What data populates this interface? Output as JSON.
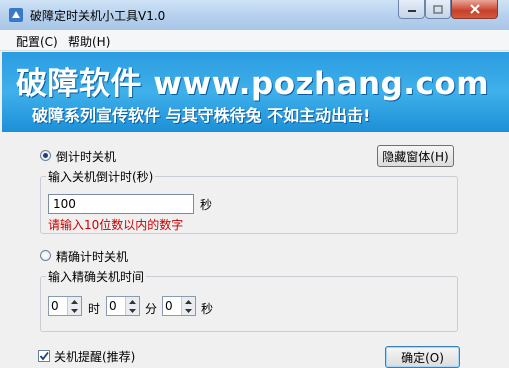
{
  "window": {
    "title": "破障定时关机小工具V1.0"
  },
  "menu": {
    "items": [
      "配置(C)",
      "帮助(H)"
    ]
  },
  "banner": {
    "title": "破障软件 www.pozhang.com",
    "subtitle": "破障系列宣传软件 与其守株待兔 不如主动出击!"
  },
  "countdown": {
    "radio_label": "倒计时关机",
    "selected": true,
    "group_label": "输入关机倒计时(秒)",
    "input_value": "100",
    "unit": "秒",
    "hint": "请输入10位数以内的数字",
    "hide_button": "隐藏窗体(H)"
  },
  "exact": {
    "radio_label": "精确计时关机",
    "selected": false,
    "group_label": "输入精确关机时间",
    "hour": "0",
    "hour_unit": "时",
    "minute": "0",
    "minute_unit": "分",
    "second": "0",
    "second_unit": "秒"
  },
  "footer": {
    "reminder_label": "关机提醒(推荐)",
    "reminder_checked": true,
    "ok_button": "确定(O)"
  },
  "icons": [
    "app-icon",
    "minimize-icon",
    "maximize-icon",
    "close-icon",
    "spin-up-icon",
    "spin-down-icon",
    "checkmark-icon"
  ]
}
